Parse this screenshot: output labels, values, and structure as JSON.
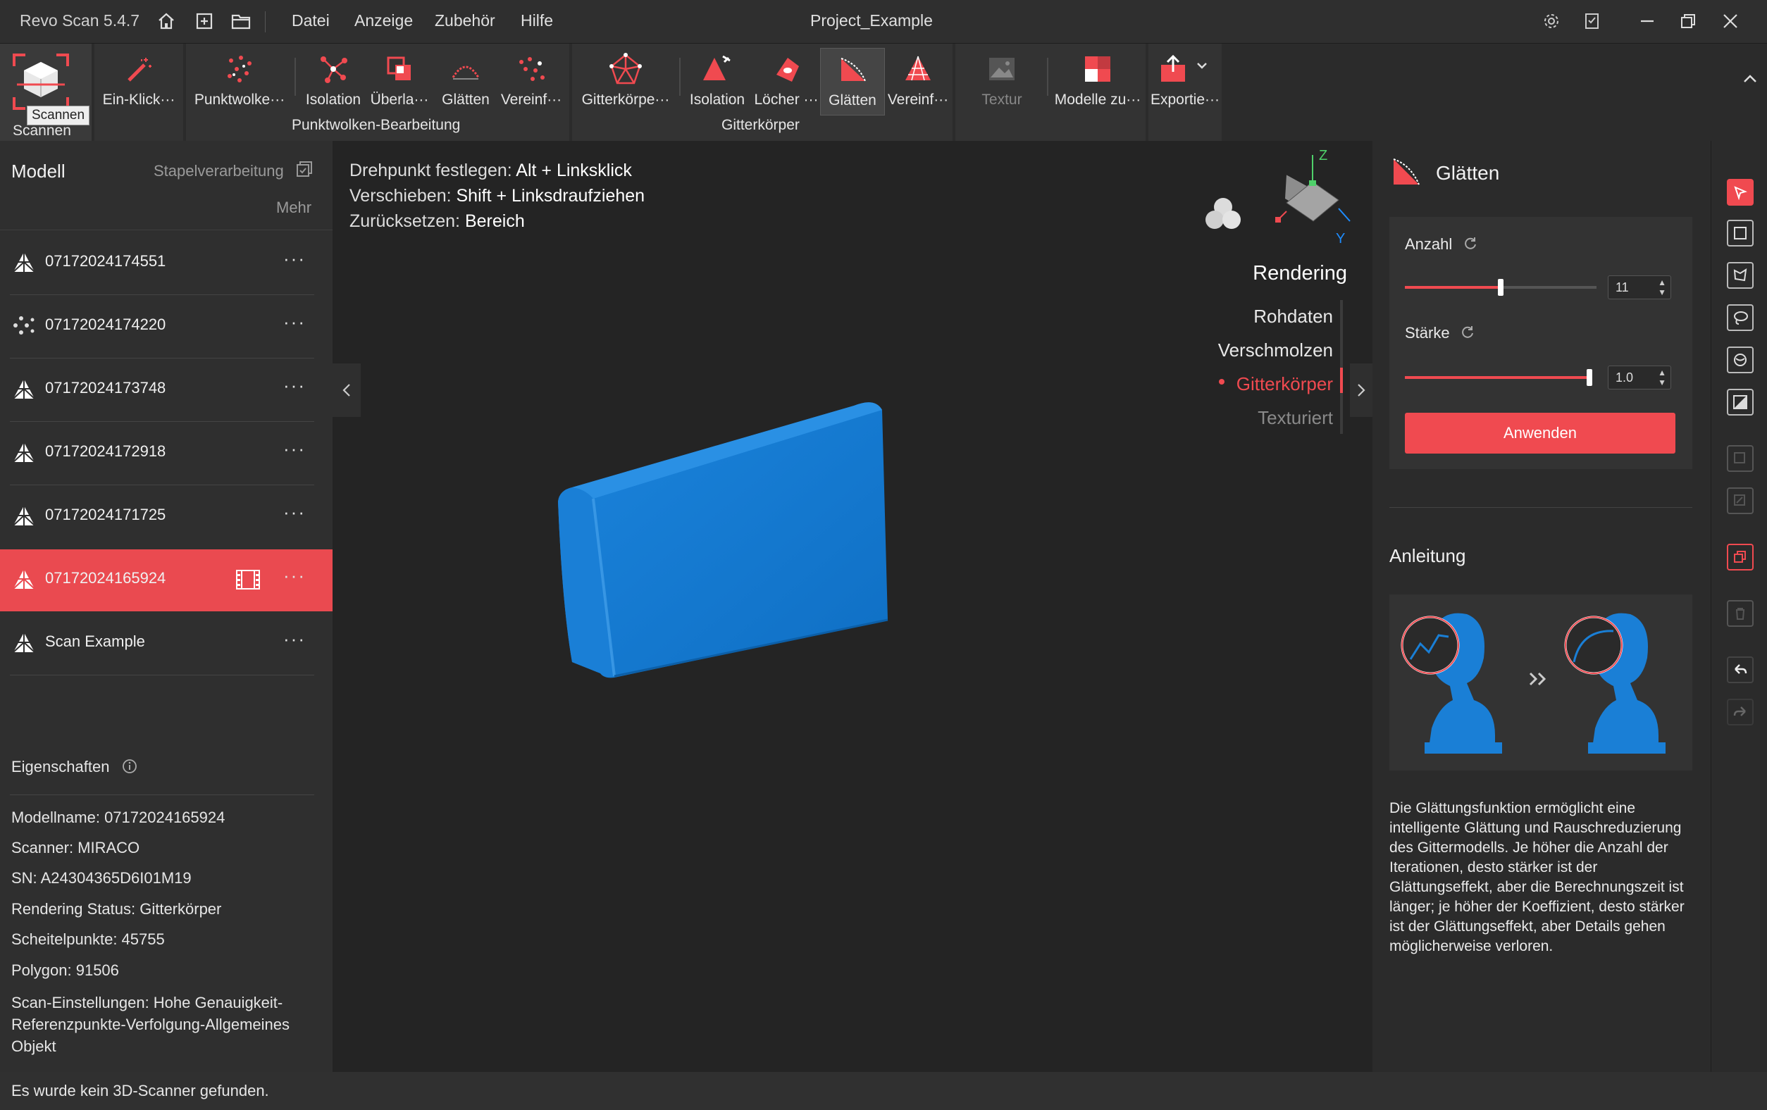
{
  "titlebar": {
    "app_title": "Revo Scan 5.4.7",
    "menu": [
      "Datei",
      "Anzeige",
      "Zubehör",
      "Hilfe"
    ],
    "project_name": "Project_Example"
  },
  "toolbar": {
    "scan_label": "Scannen",
    "scan_tooltip": "Scannen",
    "one_click_label": "Ein-Klick···",
    "point_cloud_label": "Punktwolke···",
    "pc_isolation_label": "Isolation",
    "pc_overlap_label": "Überla···",
    "pc_smooth_label": "Glätten",
    "pc_simplify_label": "Vereinf···",
    "pointcloud_group": "Punktwolken-Bearbeitung",
    "mesh_label": "Gitterkörpe···",
    "mesh_isolation_label": "Isolation",
    "mesh_holes_label": "Löcher ···",
    "mesh_smooth_label": "Glätten",
    "mesh_simplify_label": "Vereinf···",
    "mesh_group": "Gitterkörper",
    "texture_label": "Textur",
    "merge_label": "Modelle zu···",
    "export_label": "Exportie···"
  },
  "left": {
    "title": "Modell",
    "batch": "Stapelverarbeitung",
    "more": "Mehr",
    "models": [
      {
        "name": "07172024174551",
        "kind": "mesh",
        "selected": false
      },
      {
        "name": "07172024174220",
        "kind": "points",
        "selected": false
      },
      {
        "name": "07172024173748",
        "kind": "mesh",
        "selected": false
      },
      {
        "name": "07172024172918",
        "kind": "mesh",
        "selected": false
      },
      {
        "name": "07172024171725",
        "kind": "mesh",
        "selected": false
      },
      {
        "name": "07172024165924",
        "kind": "mesh",
        "selected": true
      },
      {
        "name": "Scan Example",
        "kind": "mesh",
        "selected": false
      }
    ],
    "dots": "···",
    "properties_title": "Eigenschaften",
    "properties": {
      "model_name": "Modellname:  07172024165924",
      "scanner": "Scanner:  MIRACO",
      "sn": "SN:  A24304365D6I01M19",
      "render_status": "Rendering Status:  Gitterkörper",
      "vertices": "Scheitelpunkte:  45755",
      "polygon": "Polygon:  91506",
      "scan_settings": "Scan-Einstellungen:  Hohe Genauigkeit-Referenzpunkte-Verfolgung-Allgemeines Objekt"
    }
  },
  "viewport": {
    "hint1_label": "Drehpunkt festlegen:",
    "hint1_value": "Alt + Linksklick",
    "hint2_label": "Verschieben:",
    "hint2_value": "Shift + Linksdraufziehen",
    "hint3_label": "Zurücksetzen:",
    "hint3_value": "Bereich",
    "rendering_title": "Rendering",
    "render_modes": [
      "Rohdaten",
      "Verschmolzen",
      "Gitterkörper",
      "Texturiert"
    ],
    "active_mode": "Gitterkörper",
    "axis_z": "Z",
    "axis_y": "Y",
    "model_color": "#1a7fd6"
  },
  "right": {
    "title": "Glätten",
    "count_label": "Anzahl",
    "count_value": "11",
    "count_slider_fraction": 0.5,
    "strength_label": "Stärke",
    "strength_value": "1.0",
    "strength_slider_fraction": 1.0,
    "apply_label": "Anwenden",
    "guide_title": "Anleitung",
    "guide_text": "Die Glättungsfunktion ermöglicht eine intelligente Glättung und Rauschreduzierung des Gittermodells. Je höher die Anzahl der Iterationen, desto stärker ist der Glättungseffekt, aber die Berechnungszeit ist länger; je höher der Koeffizient, desto stärker ist der Glättungseffekt, aber Details gehen möglicherweise verloren."
  },
  "status": {
    "message": "Es wurde kein 3D-Scanner gefunden."
  },
  "colors": {
    "accent": "#f04a50",
    "selected_row": "#ea4a50",
    "panel": "#2f2f2f",
    "viewport": "#242424"
  }
}
